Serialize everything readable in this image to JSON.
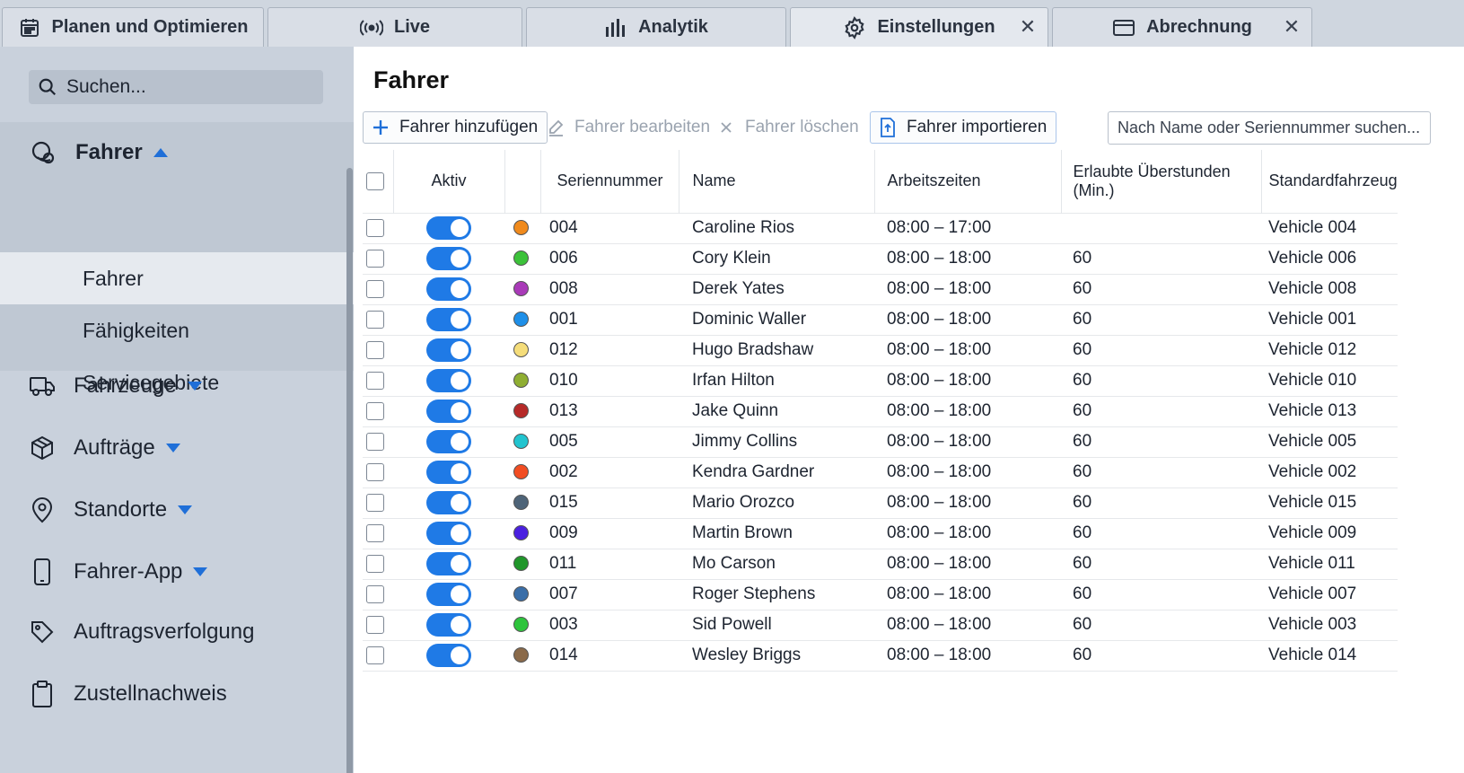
{
  "tabs": [
    {
      "label": "Planen und Optimieren",
      "icon": "calendar-icon"
    },
    {
      "label": "Live",
      "icon": "broadcast-icon"
    },
    {
      "label": "Analytik",
      "icon": "bar-chart-icon"
    },
    {
      "label": "Einstellungen",
      "icon": "gear-icon",
      "active": true,
      "close": "✕"
    },
    {
      "label": "Abrechnung",
      "icon": "credit-card-icon",
      "close": "✕"
    }
  ],
  "sidebar": {
    "search_label": "Suchen...",
    "section": {
      "label": "Fahrer",
      "icon": "user-circle-icon",
      "items": [
        {
          "label": "Fahrer",
          "active": true
        },
        {
          "label": "Fähigkeiten"
        },
        {
          "label": "Servicegebiete"
        }
      ]
    },
    "nav": [
      {
        "label": "Fahrzeuge",
        "icon": "truck-icon",
        "expandable": true
      },
      {
        "label": "Aufträge",
        "icon": "box-icon",
        "expandable": true
      },
      {
        "label": "Standorte",
        "icon": "map-pin-icon",
        "expandable": true
      },
      {
        "label": "Fahrer-App",
        "icon": "phone-icon",
        "expandable": true
      },
      {
        "label": "Auftragsverfolgung",
        "icon": "tag-icon",
        "expandable": false
      },
      {
        "label": "Zustellnachweis",
        "icon": "clipboard-icon",
        "expandable": false
      }
    ]
  },
  "main": {
    "title": "Fahrer",
    "toolbar": {
      "add": "Fahrer hinzufügen",
      "edit": "Fahrer bearbeiten",
      "delete": "Fahrer löschen",
      "import": "Fahrer importieren",
      "search_placeholder": "Nach Name oder Seriennummer suchen..."
    },
    "columns": [
      "Aktiv",
      "Seriennummer",
      "Name",
      "Arbeitszeiten",
      "Erlaubte Überstunden (Min.)",
      "Standardfahrzeug"
    ],
    "rows": [
      {
        "serial": "004",
        "name": "Caroline Rios",
        "hours": "08:00 – 17:00",
        "overtime": "",
        "vehicle": "Vehicle 004",
        "color": "#f08a1c"
      },
      {
        "serial": "006",
        "name": "Cory Klein",
        "hours": "08:00 – 18:00",
        "overtime": "60",
        "vehicle": "Vehicle 006",
        "color": "#3cc23a"
      },
      {
        "serial": "008",
        "name": "Derek Yates",
        "hours": "08:00 – 18:00",
        "overtime": "60",
        "vehicle": "Vehicle 008",
        "color": "#a93ab8"
      },
      {
        "serial": "001",
        "name": "Dominic Waller",
        "hours": "08:00 – 18:00",
        "overtime": "60",
        "vehicle": "Vehicle 001",
        "color": "#1e8fe8"
      },
      {
        "serial": "012",
        "name": "Hugo Bradshaw",
        "hours": "08:00 – 18:00",
        "overtime": "60",
        "vehicle": "Vehicle 012",
        "color": "#f5dd7a"
      },
      {
        "serial": "010",
        "name": "Irfan Hilton",
        "hours": "08:00 – 18:00",
        "overtime": "60",
        "vehicle": "Vehicle 010",
        "color": "#8fae32"
      },
      {
        "serial": "013",
        "name": "Jake Quinn",
        "hours": "08:00 – 18:00",
        "overtime": "60",
        "vehicle": "Vehicle 013",
        "color": "#b62a28"
      },
      {
        "serial": "005",
        "name": "Jimmy Collins",
        "hours": "08:00 – 18:00",
        "overtime": "60",
        "vehicle": "Vehicle 005",
        "color": "#22c4cf"
      },
      {
        "serial": "002",
        "name": "Kendra Gardner",
        "hours": "08:00 – 18:00",
        "overtime": "60",
        "vehicle": "Vehicle 002",
        "color": "#f24d22"
      },
      {
        "serial": "015",
        "name": "Mario Orozco",
        "hours": "08:00 – 18:00",
        "overtime": "60",
        "vehicle": "Vehicle 015",
        "color": "#4e6478"
      },
      {
        "serial": "009",
        "name": "Martin Brown",
        "hours": "08:00 – 18:00",
        "overtime": "60",
        "vehicle": "Vehicle 009",
        "color": "#4a20e0"
      },
      {
        "serial": "011",
        "name": "Mo Carson",
        "hours": "08:00 – 18:00",
        "overtime": "60",
        "vehicle": "Vehicle 011",
        "color": "#20962a"
      },
      {
        "serial": "007",
        "name": "Roger Stephens",
        "hours": "08:00 – 18:00",
        "overtime": "60",
        "vehicle": "Vehicle 007",
        "color": "#3a6ea8"
      },
      {
        "serial": "003",
        "name": "Sid Powell",
        "hours": "08:00 – 18:00",
        "overtime": "60",
        "vehicle": "Vehicle 003",
        "color": "#2ec43c"
      },
      {
        "serial": "014",
        "name": "Wesley Briggs",
        "hours": "08:00 – 18:00",
        "overtime": "60",
        "vehicle": "Vehicle 014",
        "color": "#8a6a4a"
      }
    ]
  }
}
